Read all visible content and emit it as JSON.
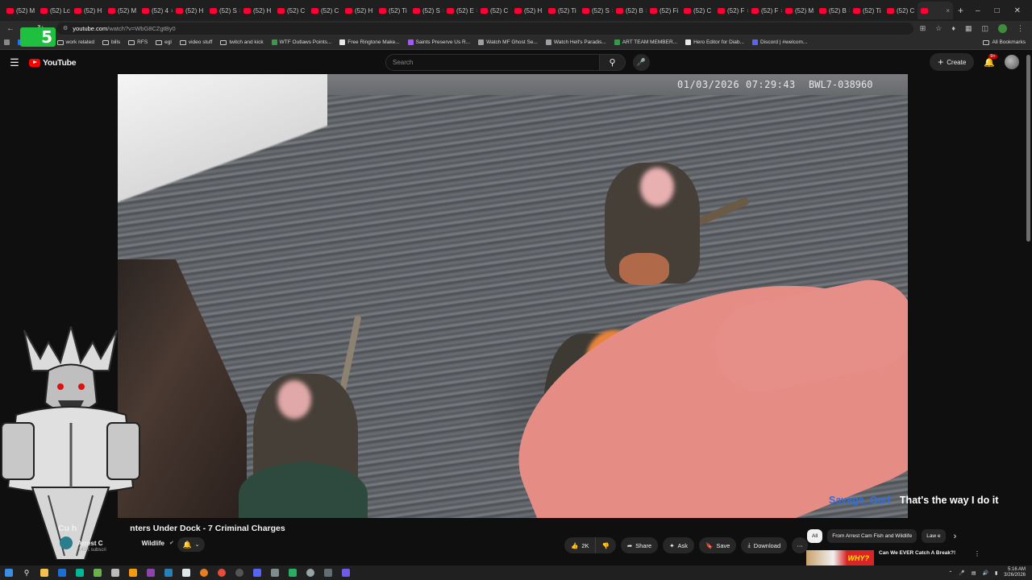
{
  "browser": {
    "tabs": [
      {
        "label": "(52) M"
      },
      {
        "label": "(52) Lc"
      },
      {
        "label": "(52) H"
      },
      {
        "label": "(52) M"
      },
      {
        "label": "(52) 4"
      },
      {
        "label": "(52) H"
      },
      {
        "label": "(52) S"
      },
      {
        "label": "(52) H"
      },
      {
        "label": "(52) C"
      },
      {
        "label": "(52) C"
      },
      {
        "label": "(52) H"
      },
      {
        "label": "(52) Ti"
      },
      {
        "label": "(52) S"
      },
      {
        "label": "(52) E"
      },
      {
        "label": "(52) C"
      },
      {
        "label": "(52) H"
      },
      {
        "label": "(52) Ti"
      },
      {
        "label": "(52) S"
      },
      {
        "label": "(52) B"
      },
      {
        "label": "(52) Fi"
      },
      {
        "label": "(52) C"
      },
      {
        "label": "(52) F"
      },
      {
        "label": "(52) F"
      },
      {
        "label": "(52) M"
      },
      {
        "label": "(52) B"
      },
      {
        "label": "(52) Ti"
      },
      {
        "label": "(52) C"
      }
    ],
    "url_host": "youtube.com",
    "url_path": "/watch?v=WbG8CZgtBy0",
    "bookmarks": [
      {
        "label": "Facebook",
        "color": "#1877f2"
      },
      {
        "label": "work related",
        "folder": true
      },
      {
        "label": "bills",
        "folder": true
      },
      {
        "label": "RFS",
        "folder": true
      },
      {
        "label": "egl",
        "folder": true
      },
      {
        "label": "video stuff",
        "folder": true
      },
      {
        "label": "twitch and kick",
        "folder": true
      },
      {
        "label": "WTF Outlaws Points...",
        "color": "#2ea043"
      },
      {
        "label": "Free Ringtone Make...",
        "color": "#e8e8e8"
      },
      {
        "label": "Saints Preserve Us R...",
        "color": "#a259ff"
      },
      {
        "label": "Watch MF Ghost Se...",
        "color": "#9aa0a6"
      },
      {
        "label": "Watch Hell's Paradis...",
        "color": "#9aa0a6"
      },
      {
        "label": "ART TEAM MEMBER...",
        "color": "#2ea043"
      },
      {
        "label": "Hero Editor for Diab...",
        "color": "#e8e8e8"
      },
      {
        "label": "Discord | #welcom...",
        "color": "#5865f2"
      }
    ],
    "all_bookmarks": "All Bookmarks"
  },
  "youtube": {
    "logo": "YouTube",
    "search_placeholder": "Search",
    "create_label": "Create",
    "notif_badge": "9+"
  },
  "video": {
    "timestamp": "01/03/2026 07:29:43",
    "device_id": "BWL7-038960",
    "title_visible": "Cu  h",
    "title_rest": "nters Under Dock - 7 Criminal Charges",
    "channel_left": "Arrest C",
    "channel_right": "Wildlife",
    "subscribers": "143K subscri"
  },
  "chat": {
    "user": "Savage_Garf",
    "message": "That's the way I do it",
    "user_color": "#2f6fdb"
  },
  "actions": {
    "like_count": "2K",
    "share": "Share",
    "ask": "Ask",
    "save": "Save",
    "download": "Download"
  },
  "sidebar": {
    "chips": [
      {
        "label": "All",
        "active": true
      },
      {
        "label": "From Arrest Cam Fish and Wildlife",
        "active": false
      },
      {
        "label": "Law e",
        "active": false
      }
    ],
    "rec_title": "Can We EVER Catch A Break?!",
    "rec_thumb_text": "WHY?"
  },
  "taskbar": {
    "time": "5:16 AM",
    "date": "3/26/2026"
  },
  "overlay": {
    "streamer_badge": "5"
  }
}
